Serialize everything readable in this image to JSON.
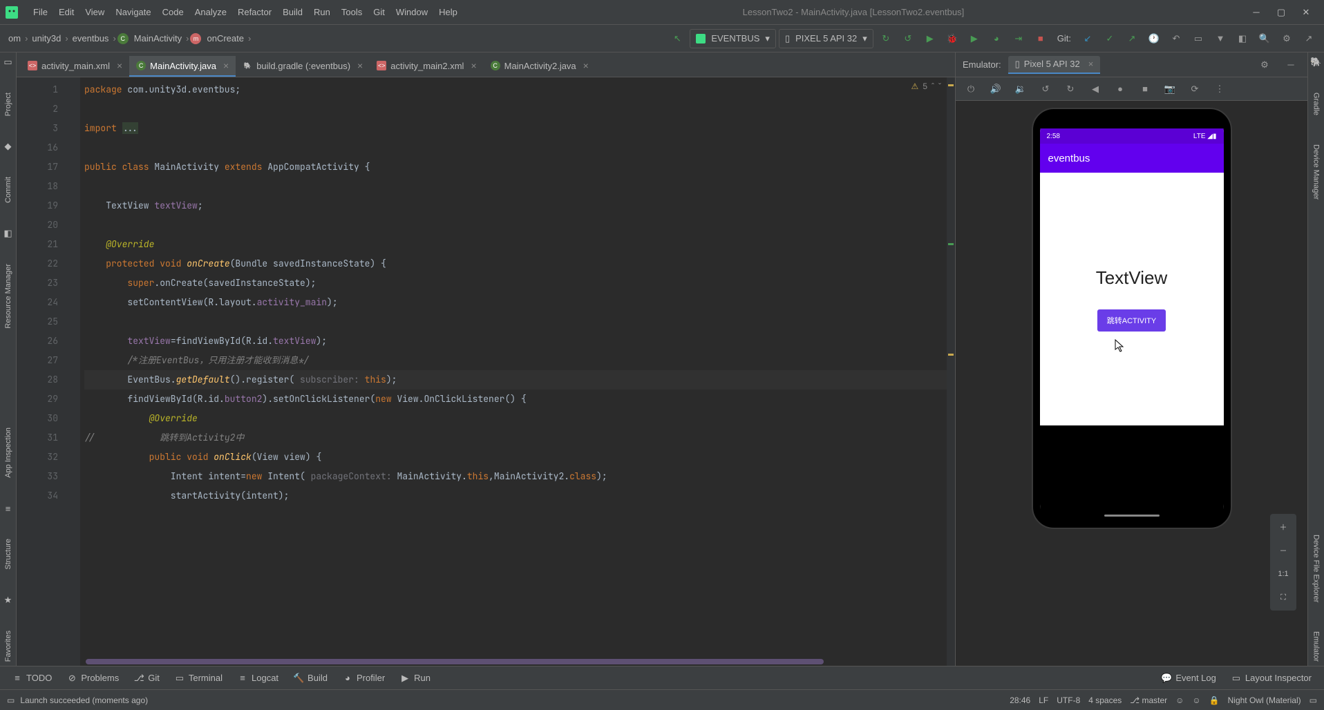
{
  "menubar": {
    "items": [
      "File",
      "Edit",
      "View",
      "Navigate",
      "Code",
      "Analyze",
      "Refactor",
      "Build",
      "Run",
      "Tools",
      "Git",
      "Window",
      "Help"
    ],
    "title": "LessonTwo2 - MainActivity.java [LessonTwo2.eventbus]"
  },
  "breadcrumb": {
    "items": [
      "om",
      "unity3d",
      "eventbus",
      "MainActivity",
      "onCreate"
    ]
  },
  "run_config": "EVENTBUS",
  "device_config": "PIXEL 5 API 32",
  "git_label": "Git:",
  "tabs": [
    {
      "name": "activity_main.xml",
      "active": false,
      "icon": "xml"
    },
    {
      "name": "MainActivity.java",
      "active": true,
      "icon": "class"
    },
    {
      "name": "build.gradle (:eventbus)",
      "active": false,
      "icon": "gradle"
    },
    {
      "name": "activity_main2.xml",
      "active": false,
      "icon": "xml"
    },
    {
      "name": "MainActivity2.java",
      "active": false,
      "icon": "class"
    }
  ],
  "inspect": {
    "warn_count": "5"
  },
  "code": {
    "lines": [
      {
        "n": "1",
        "html": "<span class='kw'>package</span> com.unity3d.eventbus;"
      },
      {
        "n": "2",
        "html": ""
      },
      {
        "n": "3",
        "html": "<span class='kw'>import</span> <span style='background:#344134'>...</span>"
      },
      {
        "n": "16",
        "html": ""
      },
      {
        "n": "17",
        "html": "<span class='kw'>public class</span> MainActivity <span class='kw'>extends</span> AppCompatActivity {"
      },
      {
        "n": "18",
        "html": ""
      },
      {
        "n": "19",
        "html": "    TextView <span class='fld'>textView</span>;"
      },
      {
        "n": "20",
        "html": ""
      },
      {
        "n": "21",
        "html": "    <span class='ann'>@Override</span>"
      },
      {
        "n": "22",
        "html": "    <span class='kw'>protected void</span> <span class='mth'>onCreate</span>(Bundle savedInstanceState) {"
      },
      {
        "n": "23",
        "html": "        <span class='kw'>super</span>.onCreate(savedInstanceState);"
      },
      {
        "n": "24",
        "html": "        setContentView(R.layout.<span class='fld'>activity_main</span>);"
      },
      {
        "n": "25",
        "html": ""
      },
      {
        "n": "26",
        "html": "        <span class='fld'>textView</span>=findViewById(R.id.<span class='fld'>textView</span>);"
      },
      {
        "n": "27",
        "html": "        <span class='cmt'>/*注册EventBus，只用注册才能收到消息*/</span>"
      },
      {
        "n": "28",
        "html": "        EventBus.<span class='mth' style='font-style:italic'>getDefault</span>().register( <span class='prm'>subscriber:</span> <span class='kw'>this</span>);",
        "cursor": true
      },
      {
        "n": "29",
        "html": "        findViewById(R.id.<span class='fld'>button2</span>).setOnClickListener(<span class='kw'>new</span> View.OnClickListener() {"
      },
      {
        "n": "30",
        "html": "            <span class='ann'>@Override</span>"
      },
      {
        "n": "31",
        "html": "<span class='cmt'>//            跳转到Activity2中</span>"
      },
      {
        "n": "32",
        "html": "            <span class='kw'>public void</span> <span class='mth'>onClick</span>(View view) {"
      },
      {
        "n": "33",
        "html": "                Intent intent=<span class='kw'>new</span> Intent( <span class='prm'>packageContext:</span> MainActivity.<span class='kw'>this</span>,MainActivity2.<span class='kw'>class</span>);"
      },
      {
        "n": "34",
        "html": "                startActivity(intent);"
      }
    ]
  },
  "emulator": {
    "header_label": "Emulator:",
    "tab_name": "Pixel 5 API 32",
    "status_time": "2:58",
    "status_right": "LTE ◢▮",
    "app_title": "eventbus",
    "textview": "TextView",
    "button": "跳转ACTIVITY"
  },
  "left_stripe": [
    "Project",
    "Resource Manager",
    "Commit",
    "App Inspection",
    "Structure",
    "Favorites"
  ],
  "right_stripe": [
    "Gradle",
    "Device Manager",
    "Device File Explorer",
    "Emulator"
  ],
  "bottom_tools": {
    "left": [
      "TODO",
      "Problems",
      "Git",
      "Terminal",
      "Logcat",
      "Build",
      "Profiler",
      "Run"
    ],
    "right": [
      "Event Log",
      "Layout Inspector"
    ]
  },
  "statusbar": {
    "left": "Launch succeeded (moments ago)",
    "caret": "28:46",
    "le": "LF",
    "enc": "UTF-8",
    "indent": "4 spaces",
    "branch": "master",
    "theme": "Night Owl (Material)"
  }
}
